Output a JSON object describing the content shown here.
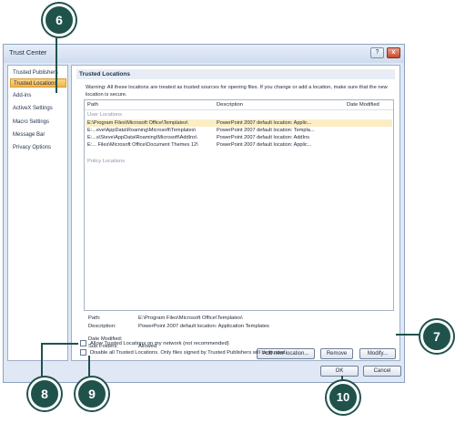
{
  "window": {
    "title": "Trust Center",
    "help_icon": "?",
    "close_icon": "x"
  },
  "sidebar": {
    "items": [
      {
        "label": "Trusted Publishers",
        "active": false
      },
      {
        "label": "Trusted Locations",
        "active": true
      },
      {
        "label": "Add-ins",
        "active": false
      },
      {
        "label": "ActiveX Settings",
        "active": false
      },
      {
        "label": "Macro Settings",
        "active": false
      },
      {
        "label": "Message Bar",
        "active": false
      },
      {
        "label": "Privacy Options",
        "active": false
      }
    ]
  },
  "main": {
    "section_title": "Trusted Locations",
    "warning": "Warning: All these locations are treated as trusted sources for opening files.  If you change or add a location, make sure that the new location is secure.",
    "columns": [
      "Path",
      "Description",
      "Date Modified"
    ],
    "user_locations_label": "User Locations",
    "rows": [
      {
        "path": "E:\\Program Files\\Microsoft Office\\Templates\\",
        "description": "PowerPoint 2007  default location: Applic...",
        "selected": true
      },
      {
        "path": "E:...eve\\AppData\\Roaming\\Microsoft\\Templates\\",
        "description": "PowerPoint 2007  default location: Templa..."
      },
      {
        "path": "E:...s\\Steve\\AppData\\Roaming\\Microsoft\\AddIns\\",
        "description": "PowerPoint 2007  default location: AddIns"
      },
      {
        "path": "E:... Files\\Microsoft Office\\Document Themes 12\\",
        "description": "PowerPoint 2007  default location: Applic..."
      }
    ],
    "policy_locations_label": "Policy Locations",
    "details": {
      "path_label": "Path:",
      "path_value": "E:\\Program Files\\Microsoft Office\\Templates\\",
      "description_label": "Description:",
      "description_value": "PowerPoint 2007 default location: Application Templates",
      "date_label": "Date Modified:",
      "date_value": "",
      "subfolders_label": "Sub Folders:",
      "subfolders_value": "Allowed"
    },
    "buttons": {
      "add": "Add new location...",
      "remove": "Remove",
      "modify": "Modify..."
    }
  },
  "options": {
    "allow_network": "Allow Trusted Locations on my network (not recommended)",
    "disable_all": "Disable all Trusted Locations. Only files signed by Trusted Publishers will be trusted."
  },
  "footer": {
    "ok": "OK",
    "cancel": "Cancel"
  },
  "callouts": [
    "6",
    "7",
    "8",
    "9",
    "10"
  ],
  "colors": {
    "callout": "#20524c",
    "active_item": "#f4b443",
    "dialog_bg": "#dfe8f4"
  }
}
